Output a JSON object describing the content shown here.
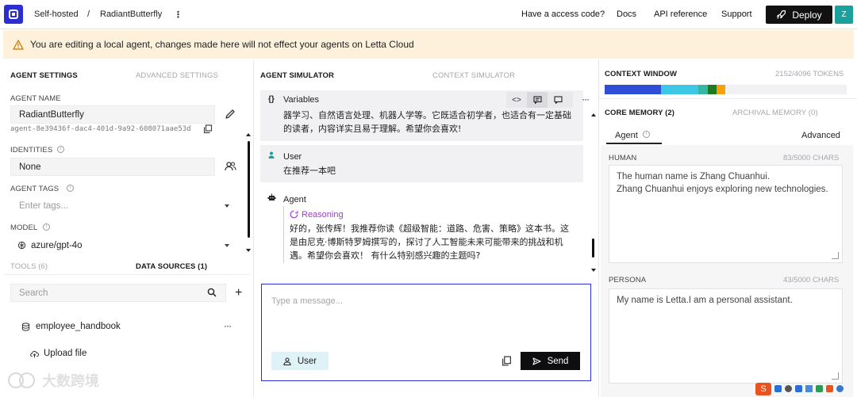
{
  "topbar": {
    "workspace": "Self-hosted",
    "separator": "/",
    "agent_name": "RadiantButterfly",
    "menu_glyph": "⋮",
    "nav": [
      "Have a access code?",
      "Docs",
      "API reference",
      "Support"
    ],
    "deploy_label": "Deploy",
    "avatar_initial": "Z"
  },
  "banner": {
    "text": "You are editing a local agent, changes made here will not effect your agents on Letta Cloud",
    "color": "#fdf1dc"
  },
  "left": {
    "tabs": [
      "AGENT SETTINGS",
      "ADVANCED SETTINGS"
    ],
    "agent_name_label": "AGENT NAME",
    "agent_name_value": "RadiantButterfly",
    "agent_id": "agent-8e39436f-dac4-401d-9a92-608071aae53d",
    "identities_label": "IDENTITIES",
    "identities_value": "None",
    "tags_label": "AGENT TAGS",
    "tags_placeholder": "Enter tags...",
    "model_label": "MODEL",
    "model_value": "azure/gpt-4o",
    "bottom_tabs": [
      "TOOLS (6)",
      "DATA SOURCES (1)"
    ],
    "search_placeholder": "Search",
    "source_name": "employee_handbook",
    "upload_label": "Upload file"
  },
  "simulator": {
    "tabs": [
      "AGENT SIMULATOR",
      "CONTEXT SIMULATOR"
    ],
    "variables_label": "Variables",
    "variables_text_1": "器学习、自然语言处理、机器人学等。它既适合初学者，也适合有一定基础",
    "variables_text_2": "的读者，内容详实且易于理解。希望你会喜欢!",
    "user_label": "User",
    "user_text": "在推荐一本吧",
    "agent_label": "Agent",
    "reasoning_label": "Reasoning",
    "agent_text_1": "好的，张传辉！我推荐你读《超级智能：道路、危害、策略》这本书。这",
    "agent_text_2": "是由尼克·博斯特罗姆撰写的，探讨了人工智能未来可能带来的挑战和机",
    "agent_text_3": "遇。希望你会喜欢！ 有什么特别感兴趣的主题吗?",
    "input_placeholder": "Type a message...",
    "role_button": "User",
    "send_label": "Send"
  },
  "context": {
    "title": "CONTEXT WINDOW",
    "tokens": "2152/4096 TOKENS",
    "usage_fraction": 0.525,
    "segments": [
      {
        "color": "#2f4ed6",
        "fraction": 0.232
      },
      {
        "color": "#3dc7e6",
        "fraction": 0.155
      },
      {
        "color": "#36b7a2",
        "fraction": 0.039
      },
      {
        "color": "#1f7a1f",
        "fraction": 0.035
      },
      {
        "color": "#f4a20a",
        "fraction": 0.039
      }
    ],
    "memory_tabs": [
      "CORE MEMORY (2)",
      "ARCHIVAL MEMORY (0)"
    ],
    "sub_tabs": [
      "Agent",
      "Advanced"
    ],
    "human_label": "HUMAN",
    "human_chars": "83/5000 CHARS",
    "human_line_1": "The human name is Zhang Chuanhui.",
    "human_line_2": "Zhang Chuanhui enjoys exploring new technologies.",
    "persona_label": "PERSONA",
    "persona_chars": "43/5000 CHARS",
    "persona_text": "My name is Letta.I am a personal assistant."
  },
  "watermark": {
    "text": "大数跨境"
  }
}
